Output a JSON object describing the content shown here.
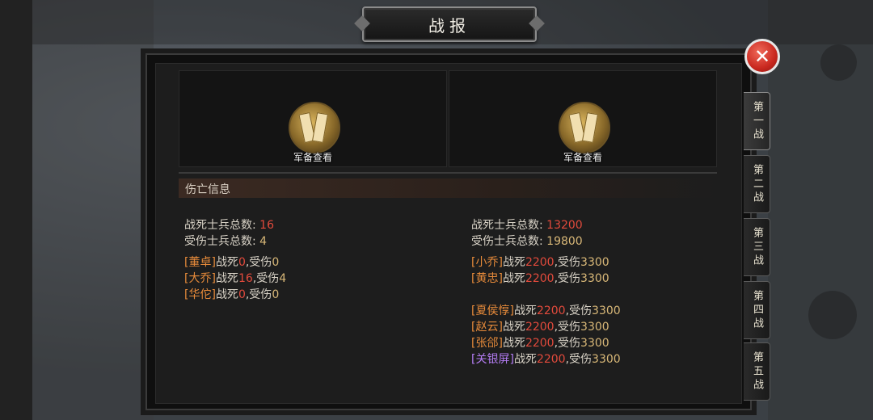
{
  "title": "战报",
  "army_view_label_left": "军备查看",
  "army_view_label_right": "军备查看",
  "casualty_title": "伤亡信息",
  "left": {
    "dead_label": "战死士兵总数:",
    "dead_value": "16",
    "wounded_label": "受伤士兵总数:",
    "wounded_value": "4",
    "generals": [
      {
        "name": "[董卓]",
        "dead_label": "战死",
        "dead": "0",
        "wounded_label": ",受伤",
        "wounded": "0"
      },
      {
        "name": "[大乔]",
        "dead_label": "战死",
        "dead": "16",
        "wounded_label": ",受伤",
        "wounded": "4"
      },
      {
        "name": "[华佗]",
        "dead_label": "战死",
        "dead": "0",
        "wounded_label": ",受伤",
        "wounded": "0"
      }
    ]
  },
  "right": {
    "dead_label": "战死士兵总数:",
    "dead_value": "13200",
    "wounded_label": "受伤士兵总数:",
    "wounded_value": "19800",
    "generals": [
      {
        "name": "[小乔]",
        "dead_label": "战死",
        "dead": "2200",
        "wounded_label": ",受伤",
        "wounded": "3300"
      },
      {
        "name": "[黄忠]",
        "dead_label": "战死",
        "dead": "2200",
        "wounded_label": ",受伤",
        "wounded": "3300"
      },
      {
        "name": "[夏侯惇]",
        "dead_label": "战死",
        "dead": "2200",
        "wounded_label": ",受伤",
        "wounded": "3300"
      },
      {
        "name": "[赵云]",
        "dead_label": "战死",
        "dead": "2200",
        "wounded_label": ",受伤",
        "wounded": "3300"
      },
      {
        "name": "[张郃]",
        "dead_label": "战死",
        "dead": "2200",
        "wounded_label": ",受伤",
        "wounded": "3300"
      },
      {
        "name": "[关银屏]",
        "dead_label": "战死",
        "dead": "2200",
        "wounded_label": ",受伤",
        "wounded": "3300"
      }
    ]
  },
  "tabs": [
    "第一战",
    "第二战",
    "第三战",
    "第四战",
    "第五战"
  ],
  "close_symbol": "✕",
  "colors": {
    "red": "#e24a3c",
    "gold": "#d9b878",
    "orange": "#e68a3a",
    "purple": "#b37cf2"
  }
}
